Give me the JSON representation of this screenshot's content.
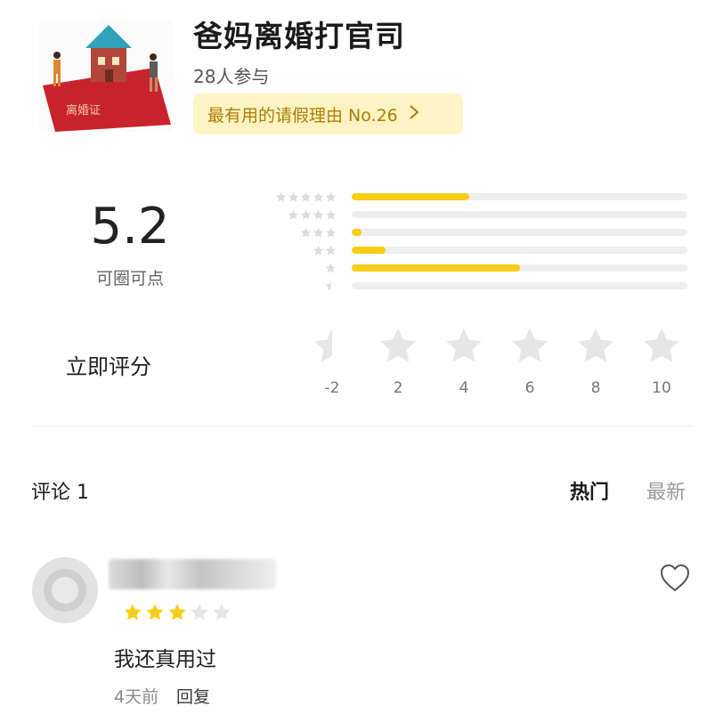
{
  "header": {
    "title": "爸妈离婚打官司",
    "participants": "28人参与",
    "rank_label": "最有用的请假理由 No.26",
    "thumbnail_caption": "离婚证"
  },
  "rating": {
    "score": "5.2",
    "score_label": "可圈可点",
    "distribution": [
      {
        "stars": 5,
        "fraction": 0.35
      },
      {
        "stars": 4,
        "fraction": 0.0
      },
      {
        "stars": 3,
        "fraction": 0.03
      },
      {
        "stars": 2,
        "fraction": 0.1
      },
      {
        "stars": 1,
        "fraction": 0.5
      },
      {
        "stars": 0.5,
        "fraction": 0.0
      }
    ],
    "rate_now_label": "立即评分",
    "rate_scale": [
      "-2",
      "2",
      "4",
      "6",
      "8",
      "10"
    ]
  },
  "comments": {
    "title": "评论 1",
    "tab_hot": "热门",
    "tab_new": "最新",
    "items": [
      {
        "stars_filled": 3,
        "stars_total": 5,
        "text": "我还真用过",
        "time": "4天前",
        "reply_label": "回复"
      }
    ]
  },
  "colors": {
    "accent_yellow": "#f7cd17",
    "pill_bg": "#fdf3c4",
    "pill_text": "#b07d00",
    "star_grey": "#e6e6e6"
  },
  "icons": [
    "star-icon",
    "half-star-icon",
    "chevron-right-icon",
    "heart-icon"
  ]
}
